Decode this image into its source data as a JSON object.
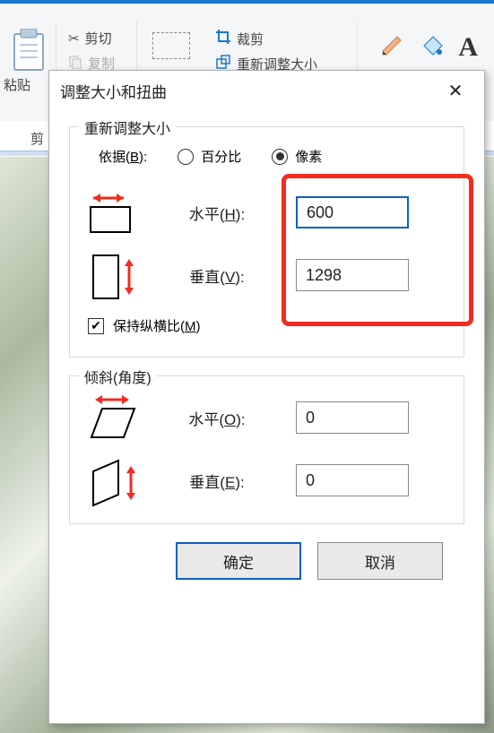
{
  "ribbon": {
    "paste_label": "粘贴",
    "cut_label": "剪切",
    "copy_label": "复制",
    "crop_label": "裁剪",
    "resize_label": "重新调整大小",
    "clip_section_label": "剪"
  },
  "dialog": {
    "title": "调整大小和扭曲",
    "resize": {
      "legend": "重新调整大小",
      "basis_label": "依据(B):",
      "radio_percent": "百分比",
      "radio_pixel": "像素",
      "horizontal_label": "水平(H):",
      "horizontal_value": "600",
      "vertical_label": "垂直(V):",
      "vertical_value": "1298",
      "aspect_label": "保持纵横比(M)"
    },
    "skew": {
      "legend": "倾斜(角度)",
      "horizontal_label": "水平(O):",
      "horizontal_value": "0",
      "vertical_label": "垂直(E):",
      "vertical_value": "0"
    },
    "ok_label": "确定",
    "cancel_label": "取消"
  }
}
